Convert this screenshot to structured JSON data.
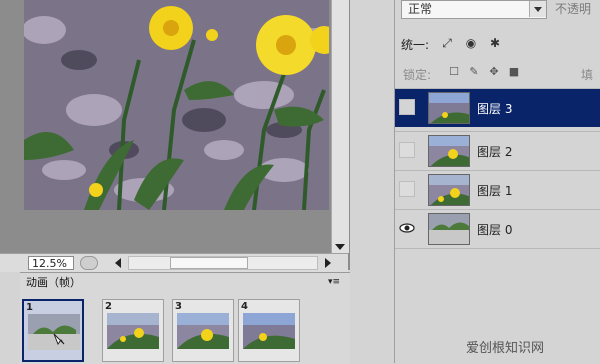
{
  "document": {
    "zoom": "12.5%"
  },
  "animation_panel": {
    "tab_label": "动画（帧）",
    "menu_icon": "panel-menu-icon",
    "frames": [
      {
        "number": "1"
      },
      {
        "number": "2"
      },
      {
        "number": "3"
      },
      {
        "number": "4"
      }
    ],
    "selected_frame": "1"
  },
  "layers_panel": {
    "blend_mode": "正常",
    "opacity_label": "不透明",
    "unify_label": "统一:",
    "lock_label": "锁定:",
    "fill_label": "填",
    "layers": [
      {
        "name": "图层 3",
        "selected": true,
        "visible": false
      },
      {
        "name": "图层 2",
        "selected": false,
        "visible": false
      },
      {
        "name": "图层 1",
        "selected": false,
        "visible": false
      },
      {
        "name": "图层 0",
        "selected": false,
        "visible": true
      }
    ]
  },
  "watermark": {
    "text": "爱创根知识网"
  },
  "colors": {
    "selection": "#0a246a",
    "flower": "#f2d21b",
    "leaf": "#3e6b33"
  }
}
